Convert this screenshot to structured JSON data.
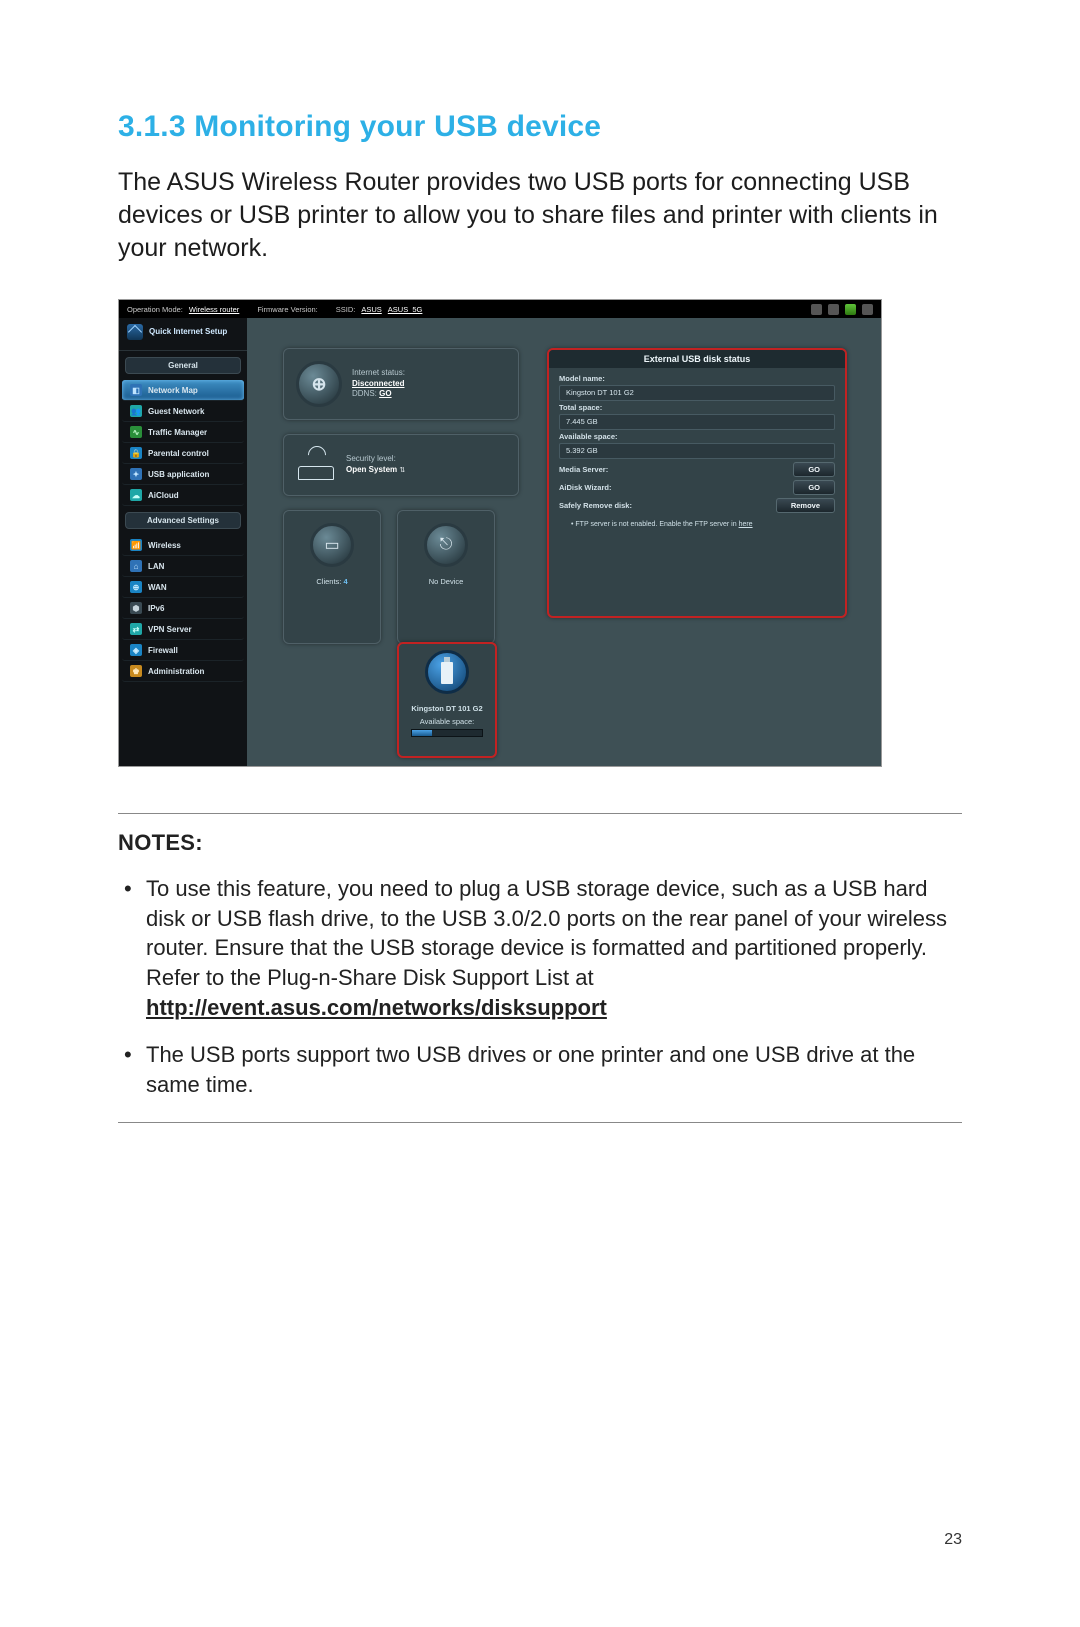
{
  "heading": "3.1.3  Monitoring your USB device",
  "intro": "The ASUS Wireless Router provides two USB ports for connecting USB devices or USB printer to allow you to share files and printer with clients in your network.",
  "page_number": "23",
  "router": {
    "topbar": {
      "op_mode_label": "Operation Mode:",
      "op_mode_value": "Wireless router",
      "fw_label": "Firmware Version:",
      "ssid_label": "SSID:",
      "ssid_value1": "ASUS",
      "ssid_value2": "ASUS_5G"
    },
    "qis": "Quick Internet Setup",
    "nav_general_header": "General",
    "nav_general": [
      "Network Map",
      "Guest Network",
      "Traffic Manager",
      "Parental control",
      "USB application",
      "AiCloud"
    ],
    "nav_adv_header": "Advanced Settings",
    "nav_adv": [
      "Wireless",
      "LAN",
      "WAN",
      "IPv6",
      "VPN Server",
      "Firewall",
      "Administration"
    ],
    "cards": {
      "internet": {
        "status_label": "Internet status:",
        "status_value": "Disconnected",
        "ddns_label": "DDNS:",
        "ddns_value": "GO"
      },
      "security": {
        "label": "Security level:",
        "value": "Open System"
      },
      "clients": {
        "label": "Clients:",
        "count": "4"
      },
      "no_device": "No Device",
      "usb_device": {
        "name": "Kingston DT 101 G2",
        "avail_label": "Available space:"
      }
    },
    "panel": {
      "title": "External USB disk status",
      "model_label": "Model name:",
      "model_value": "Kingston DT 101 G2",
      "total_label": "Total space:",
      "total_value": "7.445 GB",
      "avail_label": "Available space:",
      "avail_value": "5.392 GB",
      "media_label": "Media Server:",
      "aidisk_label": "AiDisk Wizard:",
      "go": "GO",
      "remove_label": "Safely Remove disk:",
      "remove_btn": "Remove",
      "ftp_pre": "FTP server is not enabled. Enable the FTP server in ",
      "ftp_link": "here"
    }
  },
  "notes": {
    "title": "NOTES:",
    "n1_a": "To use this feature, you need to plug a USB storage device, such as a USB hard disk or USB flash drive, to the USB 3.0/2.0 ports on the rear panel of your wireless router. Ensure that the USB storage device is formatted and partitioned properly. Refer to the Plug-n-Share Disk Support List at ",
    "n1_url": "http://event.asus.com/networks/disksupport",
    "n2": "The USB ports support two USB drives or one printer and one USB drive at the same time."
  }
}
